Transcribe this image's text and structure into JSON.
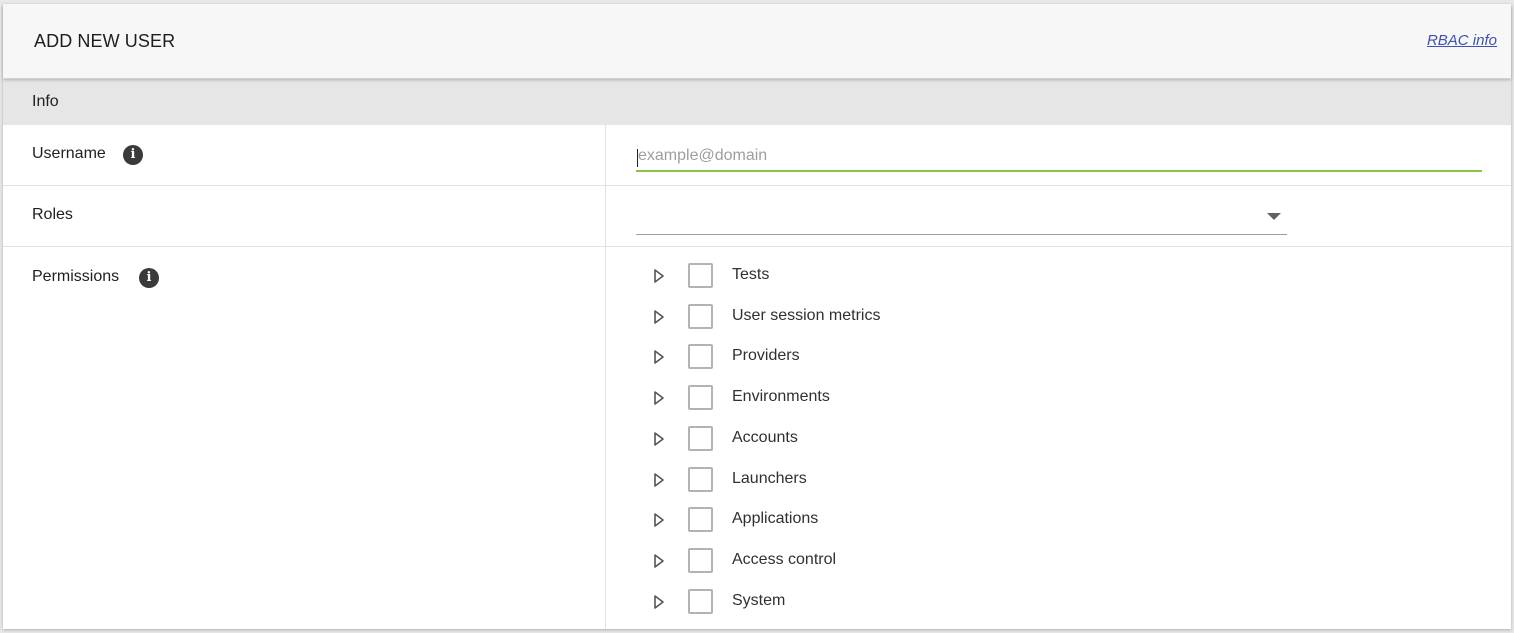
{
  "header": {
    "title": "ADD NEW USER",
    "link_label": "RBAC info"
  },
  "section": {
    "title": "Info"
  },
  "fields": {
    "username": {
      "label": "Username",
      "placeholder": "example@domain",
      "value": "",
      "info_icon": "info-icon"
    },
    "roles": {
      "label": "Roles",
      "selected": "",
      "icon": "dropdown-arrow-icon"
    },
    "permissions": {
      "label": "Permissions",
      "info_icon": "info-icon",
      "items": [
        {
          "label": "Tests",
          "checked": false
        },
        {
          "label": "User session metrics",
          "checked": false
        },
        {
          "label": "Providers",
          "checked": false
        },
        {
          "label": "Environments",
          "checked": false
        },
        {
          "label": "Accounts",
          "checked": false
        },
        {
          "label": "Launchers",
          "checked": false
        },
        {
          "label": "Applications",
          "checked": false
        },
        {
          "label": "Access control",
          "checked": false
        },
        {
          "label": "System",
          "checked": false
        }
      ]
    }
  },
  "colors": {
    "accent": "#8bc34a",
    "link": "#3f51b5",
    "header_bg": "#f7f7f7",
    "section_bg": "#e6e6e6"
  }
}
